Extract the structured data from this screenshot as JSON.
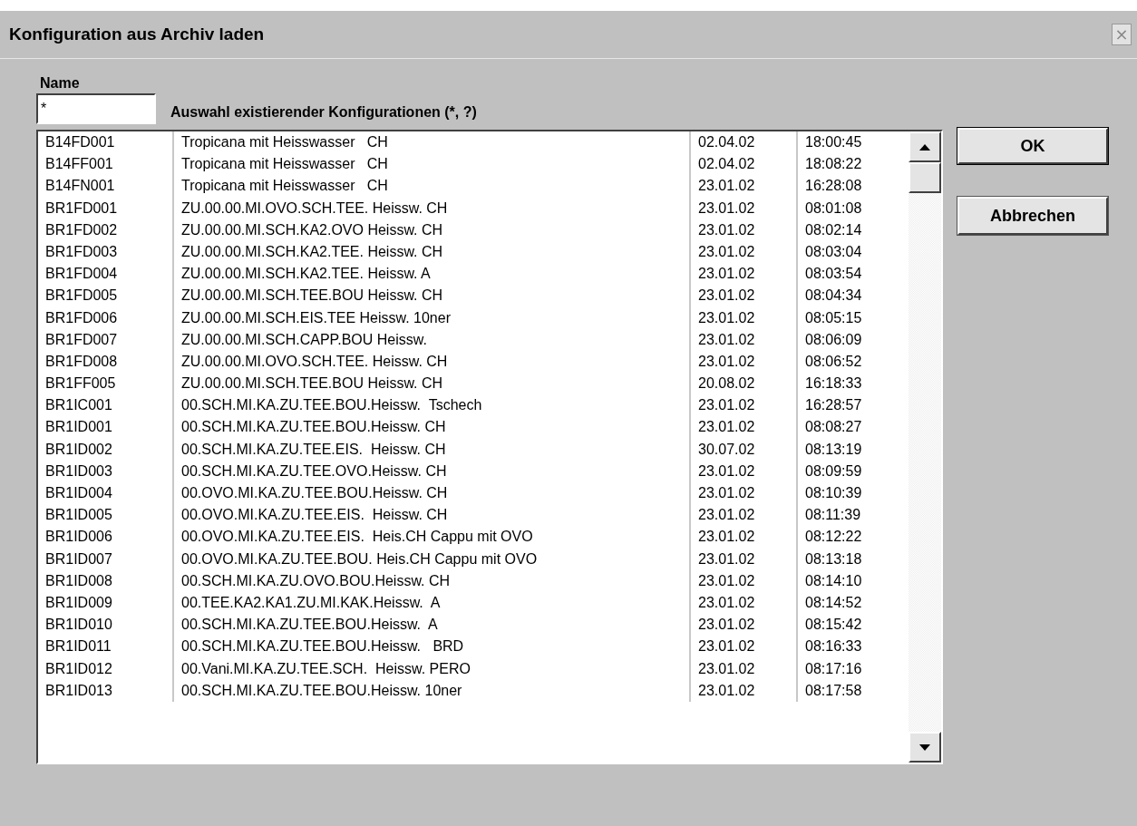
{
  "window": {
    "title": "Konfiguration aus Archiv laden"
  },
  "name_field": {
    "label": "Name",
    "value": "*"
  },
  "hint": "Auswahl existierender Konfigurationen (*, ?)",
  "rows": [
    [
      "B14FD001",
      "Tropicana mit Heisswasser   CH",
      "02.04.02",
      "18:00:45"
    ],
    [
      "B14FF001",
      "Tropicana mit Heisswasser   CH",
      "02.04.02",
      "18:08:22"
    ],
    [
      "B14FN001",
      "Tropicana mit Heisswasser   CH",
      "23.01.02",
      "16:28:08"
    ],
    [
      "BR1FD001",
      "ZU.00.00.MI.OVO.SCH.TEE. Heissw. CH",
      "23.01.02",
      "08:01:08"
    ],
    [
      "BR1FD002",
      "ZU.00.00.MI.SCH.KA2.OVO Heissw. CH",
      "23.01.02",
      "08:02:14"
    ],
    [
      "BR1FD003",
      "ZU.00.00.MI.SCH.KA2.TEE. Heissw. CH",
      "23.01.02",
      "08:03:04"
    ],
    [
      "BR1FD004",
      "ZU.00.00.MI.SCH.KA2.TEE. Heissw. A",
      "23.01.02",
      "08:03:54"
    ],
    [
      "BR1FD005",
      "ZU.00.00.MI.SCH.TEE.BOU Heissw. CH",
      "23.01.02",
      "08:04:34"
    ],
    [
      "BR1FD006",
      "ZU.00.00.MI.SCH.EIS.TEE Heissw. 10ner",
      "23.01.02",
      "08:05:15"
    ],
    [
      "BR1FD007",
      "ZU.00.00.MI.SCH.CAPP.BOU Heissw.",
      "23.01.02",
      "08:06:09"
    ],
    [
      "BR1FD008",
      "ZU.00.00.MI.OVO.SCH.TEE. Heissw. CH",
      "23.01.02",
      "08:06:52"
    ],
    [
      "BR1FF005",
      "ZU.00.00.MI.SCH.TEE.BOU Heissw. CH",
      "20.08.02",
      "16:18:33"
    ],
    [
      "BR1IC001",
      "00.SCH.MI.KA.ZU.TEE.BOU.Heissw.  Tschech",
      "23.01.02",
      "16:28:57"
    ],
    [
      "BR1ID001",
      "00.SCH.MI.KA.ZU.TEE.BOU.Heissw. CH",
      "23.01.02",
      "08:08:27"
    ],
    [
      "BR1ID002",
      "00.SCH.MI.KA.ZU.TEE.EIS.  Heissw. CH",
      "30.07.02",
      "08:13:19"
    ],
    [
      "BR1ID003",
      "00.SCH.MI.KA.ZU.TEE.OVO.Heissw. CH",
      "23.01.02",
      "08:09:59"
    ],
    [
      "BR1ID004",
      "00.OVO.MI.KA.ZU.TEE.BOU.Heissw. CH",
      "23.01.02",
      "08:10:39"
    ],
    [
      "BR1ID005",
      "00.OVO.MI.KA.ZU.TEE.EIS.  Heissw. CH",
      "23.01.02",
      "08:11:39"
    ],
    [
      "BR1ID006",
      "00.OVO.MI.KA.ZU.TEE.EIS.  Heis.CH Cappu mit OVO",
      "23.01.02",
      "08:12:22"
    ],
    [
      "BR1ID007",
      "00.OVO.MI.KA.ZU.TEE.BOU. Heis.CH Cappu mit OVO",
      "23.01.02",
      "08:13:18"
    ],
    [
      "BR1ID008",
      "00.SCH.MI.KA.ZU.OVO.BOU.Heissw. CH",
      "23.01.02",
      "08:14:10"
    ],
    [
      "BR1ID009",
      "00.TEE.KA2.KA1.ZU.MI.KAK.Heissw.  A",
      "23.01.02",
      "08:14:52"
    ],
    [
      "BR1ID010",
      "00.SCH.MI.KA.ZU.TEE.BOU.Heissw.  A",
      "23.01.02",
      "08:15:42"
    ],
    [
      "BR1ID011",
      "00.SCH.MI.KA.ZU.TEE.BOU.Heissw.   BRD",
      "23.01.02",
      "08:16:33"
    ],
    [
      "BR1ID012",
      "00.Vani.MI.KA.ZU.TEE.SCH.  Heissw. PERO",
      "23.01.02",
      "08:17:16"
    ],
    [
      "BR1ID013",
      "00.SCH.MI.KA.ZU.TEE.BOU.Heissw. 10ner",
      "23.01.02",
      "08:17:58"
    ]
  ],
  "buttons": [
    {
      "label": "OK",
      "default": true
    },
    {
      "label": "Abbrechen",
      "default": false
    }
  ],
  "close_button": {
    "label": "×"
  }
}
